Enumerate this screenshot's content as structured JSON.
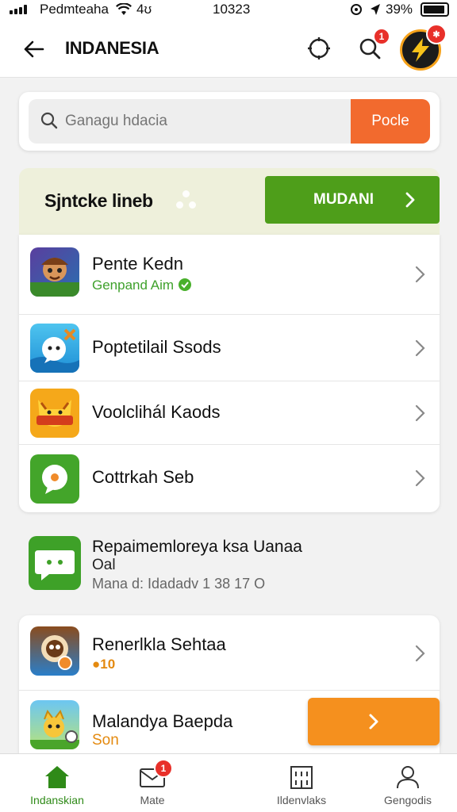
{
  "status_bar": {
    "carrier": "Pedmteaha",
    "signal_extra": "4ʊ",
    "time": "10323",
    "battery": "39%"
  },
  "app_bar": {
    "title": "INDANESIA",
    "notification_badge": "1"
  },
  "search": {
    "placeholder": "Ganagu hdacia",
    "button_label": "Pocle"
  },
  "promo": {
    "title": "Sjntcke lineb",
    "button_label": "MUDANI"
  },
  "list": [
    {
      "title": "Pente Kedn",
      "subtitle": "Genpand Aim",
      "icon": "adventure-game-icon"
    },
    {
      "title": "Poptetilail Ssods",
      "icon": "chat-bubble-game-icon"
    },
    {
      "title": "Voolclihál Kaods",
      "icon": "fox-game-icon"
    },
    {
      "title": "Cottrkah Seb",
      "icon": "green-chat-icon"
    }
  ],
  "plain_item": {
    "title": "Repaimemloreya ksa Uanaa",
    "line2": "Oal",
    "line3": "Mana d: Idadadv 1 38 17 O",
    "icon": "message-app-icon"
  },
  "list2": [
    {
      "title": "Renerlkla Sehtaa",
      "coins": "●10",
      "icon": "owl-game-icon"
    },
    {
      "title": "Malandya Baepda",
      "subtitle": "Son",
      "icon": "cartoon-game-icon"
    }
  ],
  "bottom_nav": [
    {
      "label": "Indanskian",
      "icon": "home-icon",
      "active": true
    },
    {
      "label": "Mate",
      "icon": "mail-icon",
      "badge": "1"
    },
    {
      "label": "Ildenvlaks",
      "icon": "building-icon"
    },
    {
      "label": "Gengodis",
      "icon": "profile-icon"
    }
  ],
  "colors": {
    "accent_green": "#4e9e1a",
    "accent_orange": "#f26a2e",
    "badge_red": "#e8302a",
    "promo_bg": "#eef0db"
  }
}
